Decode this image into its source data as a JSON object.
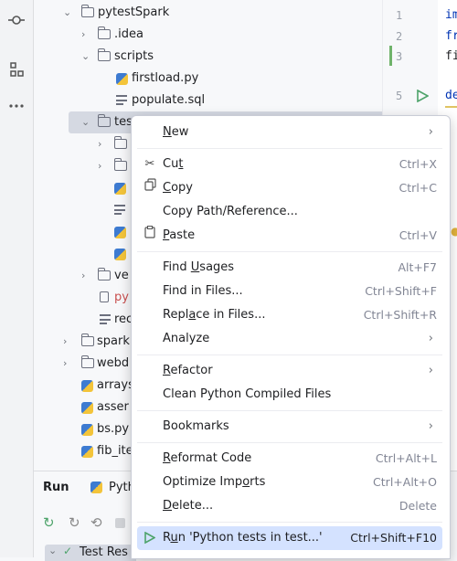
{
  "tree": {
    "root": "pytestSpark",
    "idea": ".idea",
    "scripts": "scripts",
    "firstload": "firstload.py",
    "populate": "populate.sql",
    "tests": "tes",
    "ve": "ve",
    "py": "py",
    "rec": "rec",
    "spark": "spark",
    "webd": "webd",
    "arrays": "arrays",
    "asser": "asser",
    "bs": "bs.py",
    "fib": "fib_ite"
  },
  "editor": {
    "lines": [
      "1",
      "2",
      "3",
      "5"
    ],
    "code": [
      "im",
      "fr",
      "fi",
      "de"
    ]
  },
  "run_panel": {
    "tab_run": "Run",
    "tab_py": "Pyth",
    "test_results": "Test Res"
  },
  "menu": {
    "new": {
      "pre": "",
      "u": "N",
      "post": "ew"
    },
    "cut": {
      "pre": "Cu",
      "u": "t",
      "post": "",
      "shortcut": "Ctrl+X"
    },
    "copy": {
      "pre": "",
      "u": "C",
      "post": "opy",
      "shortcut": "Ctrl+C"
    },
    "copy_path": "Copy Path/Reference...",
    "paste": {
      "pre": "",
      "u": "P",
      "post": "aste",
      "shortcut": "Ctrl+V"
    },
    "find_usages": {
      "pre": "Find ",
      "u": "U",
      "post": "sages",
      "shortcut": "Alt+F7"
    },
    "find_in_files": {
      "label": "Find in Files...",
      "shortcut": "Ctrl+Shift+F"
    },
    "replace_in_files": {
      "pre": "Repl",
      "u": "a",
      "post": "ce in Files...",
      "shortcut": "Ctrl+Shift+R"
    },
    "analyze": "Analyze",
    "refactor": {
      "pre": "",
      "u": "R",
      "post": "efactor"
    },
    "clean": "Clean Python Compiled Files",
    "bookmarks": "Bookmarks",
    "reformat": {
      "pre": "",
      "u": "R",
      "post": "eformat Code",
      "shortcut": "Ctrl+Alt+L"
    },
    "optimize": {
      "pre": "Optimize Imp",
      "u": "o",
      "post": "rts",
      "shortcut": "Ctrl+Alt+O"
    },
    "delete": {
      "pre": "",
      "u": "D",
      "post": "elete...",
      "shortcut": "Delete"
    },
    "run_tests": {
      "pre": "R",
      "u": "u",
      "post": "n 'Python tests in test...'",
      "shortcut": "Ctrl+Shift+F10"
    }
  },
  "colors": {
    "highlight": "#d4e2ff",
    "selection": "#d5d9e2",
    "run_green": "#4da36a"
  }
}
